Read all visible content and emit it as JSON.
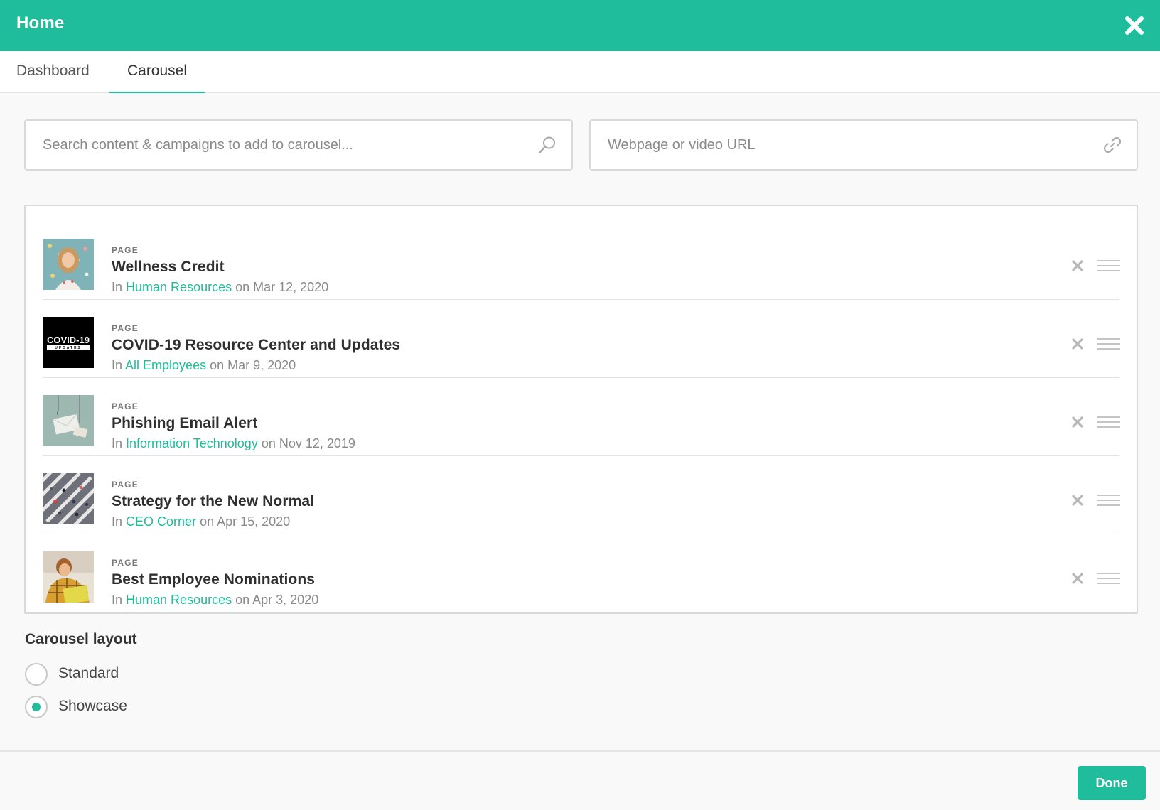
{
  "header": {
    "title": "Home",
    "close_icon": "close-icon"
  },
  "tabs": [
    {
      "label": "Dashboard",
      "active": false
    },
    {
      "label": "Carousel",
      "active": true
    }
  ],
  "search": {
    "placeholder": "Search content & campaigns to add to carousel...",
    "value": "",
    "icon": "search-icon"
  },
  "url_input": {
    "placeholder": "Webpage or video URL",
    "value": "",
    "icon": "link-icon"
  },
  "items": [
    {
      "kind": "PAGE",
      "title": "Wellness Credit",
      "prefix": "In",
      "group": "Human Resources",
      "suffix": "on Mar 12, 2020"
    },
    {
      "kind": "PAGE",
      "title": "COVID-19 Resource Center and Updates",
      "prefix": "In",
      "group": "All Employees",
      "suffix": "on Mar 9, 2020",
      "thumb_text": "COVID-19",
      "thumb_subtext": "UPDATES"
    },
    {
      "kind": "PAGE",
      "title": "Phishing Email Alert",
      "prefix": "In",
      "group": "Information Technology",
      "suffix": "on Nov 12, 2019"
    },
    {
      "kind": "PAGE",
      "title": "Strategy for the New Normal",
      "prefix": "In",
      "group": "CEO Corner",
      "suffix": "on Apr 15, 2020"
    },
    {
      "kind": "PAGE",
      "title": "Best Employee Nominations",
      "prefix": "In",
      "group": "Human Resources",
      "suffix": "on Apr 3, 2020"
    }
  ],
  "layout": {
    "label": "Carousel layout",
    "options": [
      {
        "label": "Standard",
        "selected": false
      },
      {
        "label": "Showcase",
        "selected": true
      }
    ]
  },
  "footer": {
    "done_label": "Done"
  },
  "colors": {
    "accent": "#20bd9c",
    "border": "#d9d9d9",
    "muted": "#8a8a8a"
  }
}
